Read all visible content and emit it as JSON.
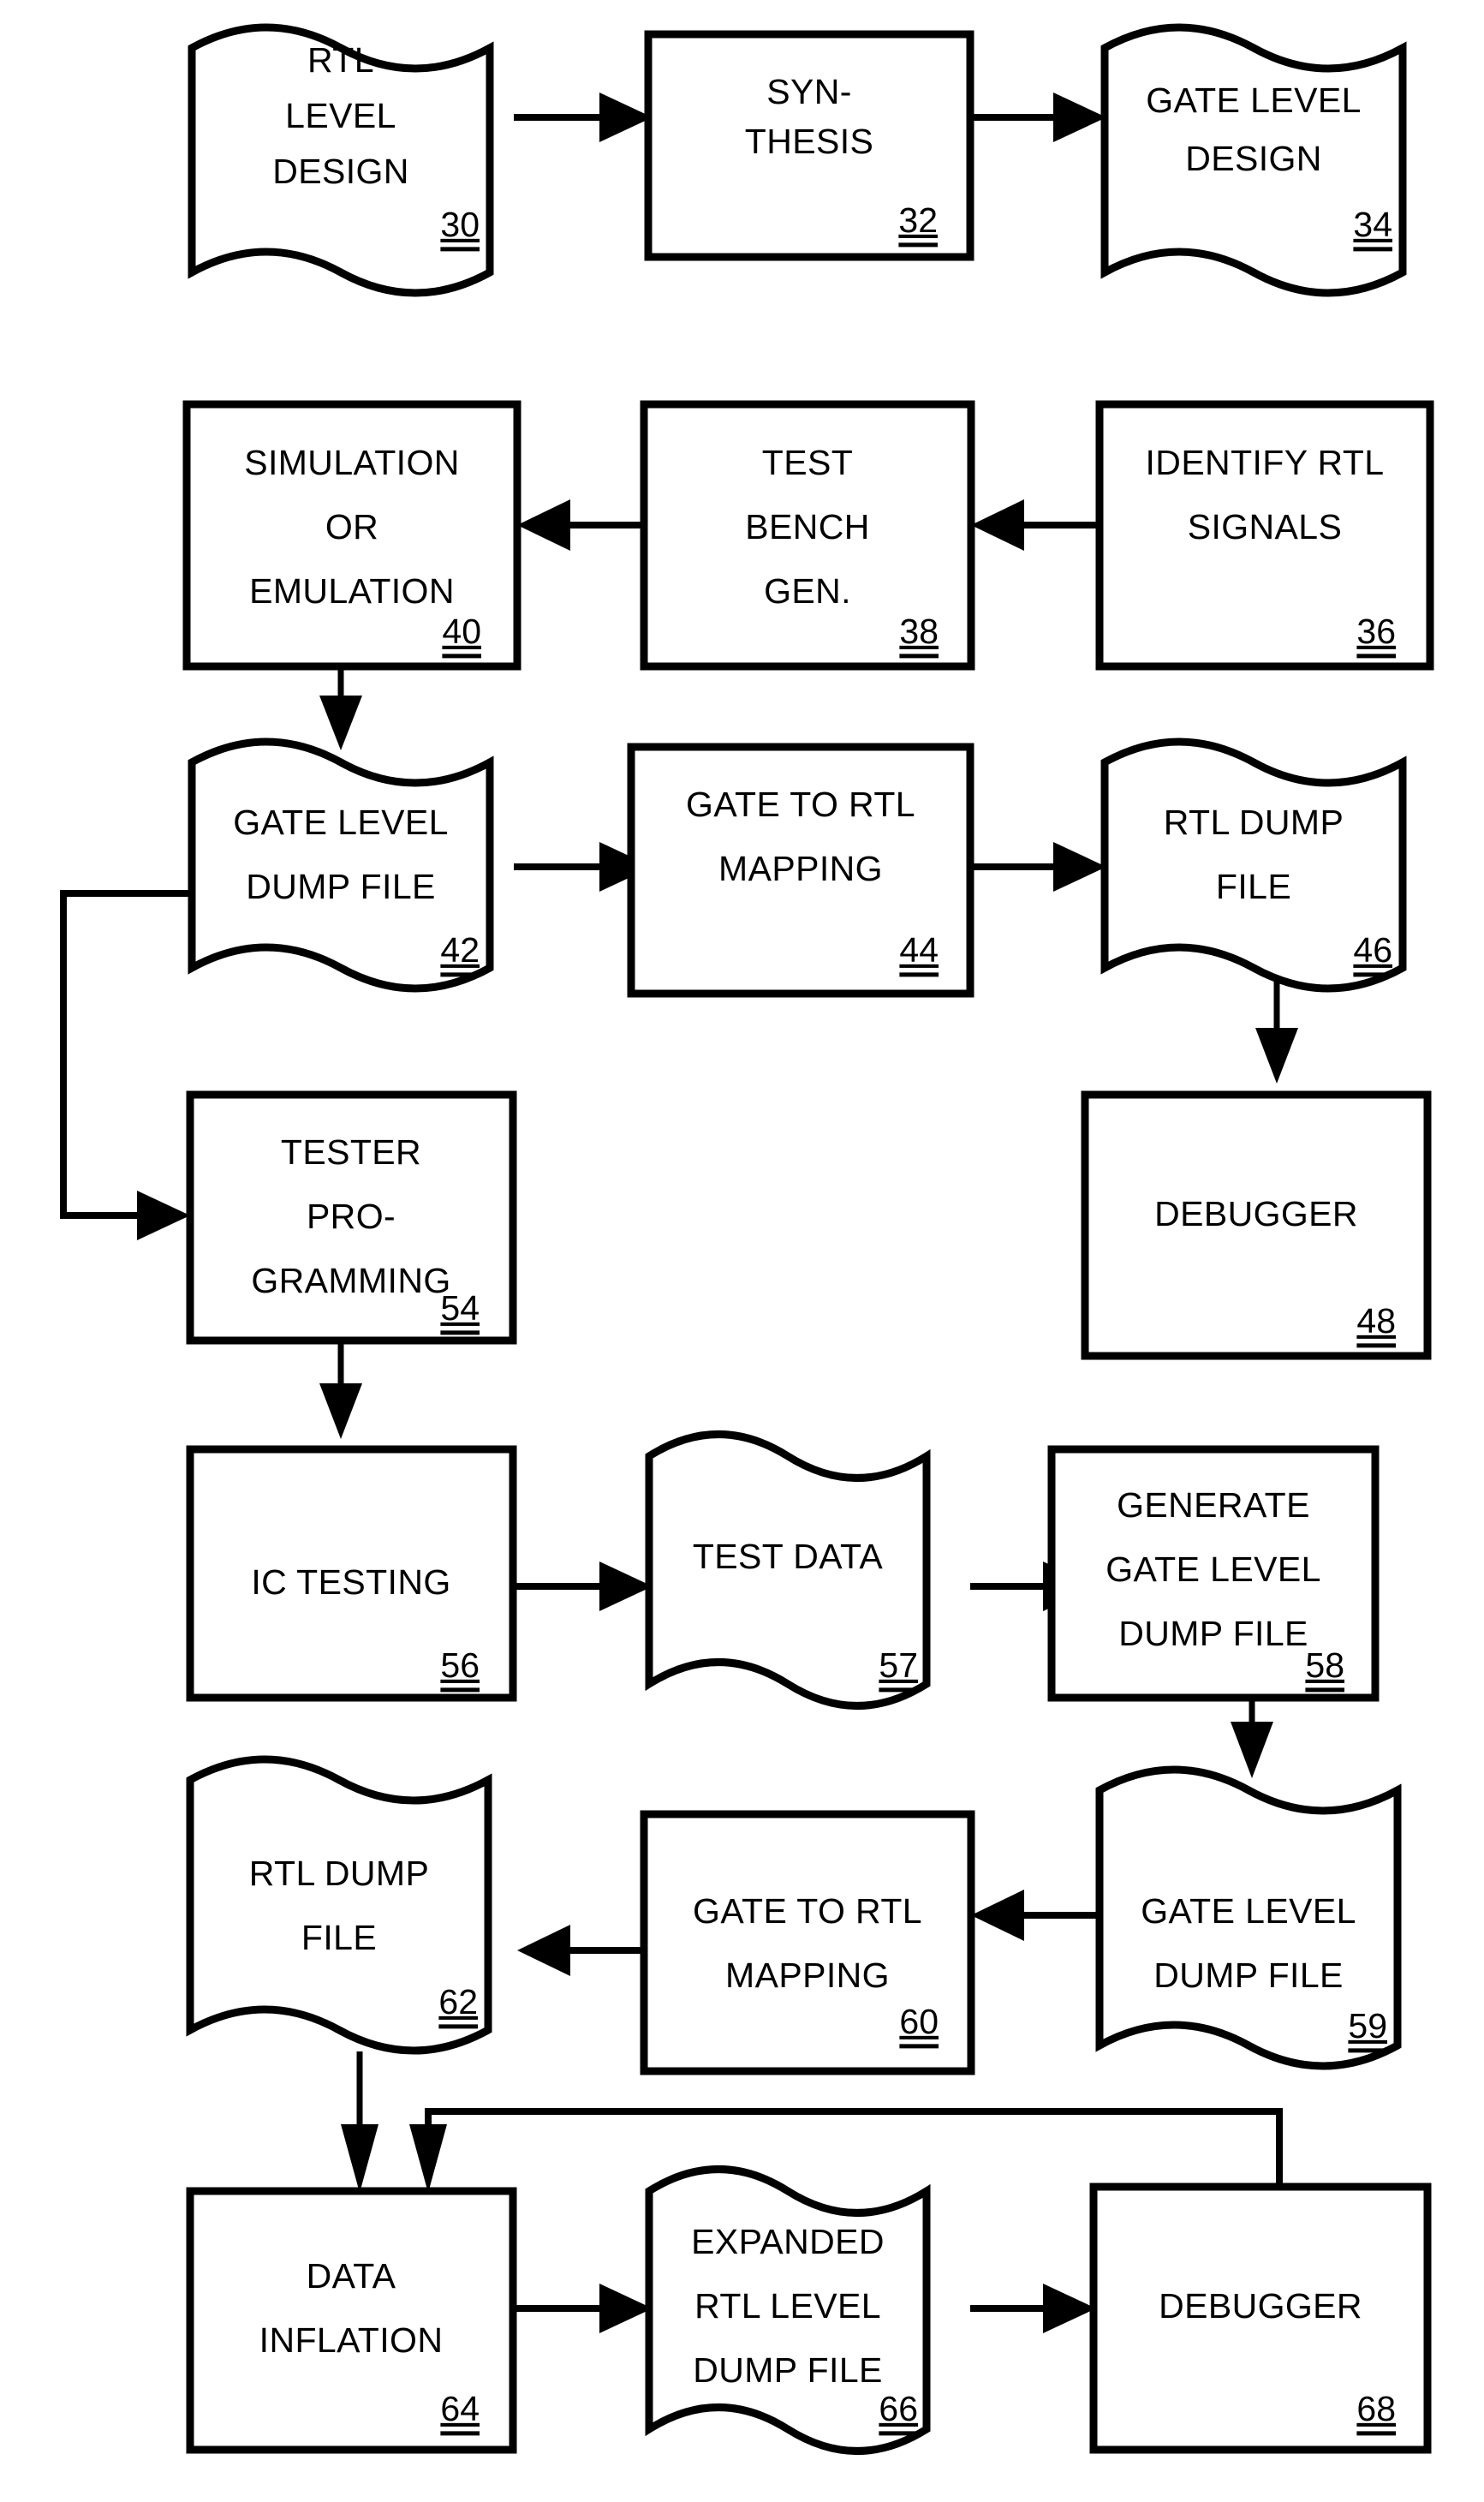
{
  "figure": {
    "type": "patent-flowchart",
    "orientation": "portrait",
    "line_color": "#000000",
    "fill_color": "#ffffff"
  },
  "nodes": [
    {
      "id": "n30",
      "ref": "30",
      "shape": "document",
      "lines": [
        "RTL",
        "LEVEL",
        "DESIGN"
      ],
      "col": 1,
      "row": 1
    },
    {
      "id": "n32",
      "ref": "32",
      "shape": "rect",
      "lines": [
        "SYN-",
        "THESIS"
      ],
      "col": 2,
      "row": 1
    },
    {
      "id": "n34",
      "ref": "34",
      "shape": "document",
      "lines": [
        "GATE LEVEL",
        "DESIGN"
      ],
      "col": 3,
      "row": 1
    },
    {
      "id": "n40",
      "ref": "40",
      "shape": "rect",
      "lines": [
        "SIMULATION",
        "OR",
        "EMULATION"
      ],
      "col": 1,
      "row": 2
    },
    {
      "id": "n38",
      "ref": "38",
      "shape": "rect",
      "lines": [
        "TEST",
        "BENCH",
        "GEN."
      ],
      "col": 2,
      "row": 2
    },
    {
      "id": "n36",
      "ref": "36",
      "shape": "rect",
      "lines": [
        "IDENTIFY RTL",
        "SIGNALS"
      ],
      "col": 3,
      "row": 2
    },
    {
      "id": "n42",
      "ref": "42",
      "shape": "document",
      "lines": [
        "GATE LEVEL",
        "DUMP FILE"
      ],
      "col": 1,
      "row": 3
    },
    {
      "id": "n44",
      "ref": "44",
      "shape": "rect",
      "lines": [
        "GATE TO RTL",
        "MAPPING"
      ],
      "col": 2,
      "row": 3
    },
    {
      "id": "n46",
      "ref": "46",
      "shape": "document",
      "lines": [
        "RTL DUMP",
        "FILE"
      ],
      "col": 3,
      "row": 3
    },
    {
      "id": "n54",
      "ref": "54",
      "shape": "rect",
      "lines": [
        "TESTER",
        "PRO-",
        "GRAMMING"
      ],
      "col": 1,
      "row": 4
    },
    {
      "id": "n48",
      "ref": "48",
      "shape": "rect",
      "lines": [
        "DEBUGGER"
      ],
      "col": 3,
      "row": 4
    },
    {
      "id": "n56",
      "ref": "56",
      "shape": "rect",
      "lines": [
        "IC TESTING"
      ],
      "col": 1,
      "row": 5
    },
    {
      "id": "n57",
      "ref": "57",
      "shape": "document",
      "lines": [
        "TEST DATA"
      ],
      "col": 2,
      "row": 5
    },
    {
      "id": "n58",
      "ref": "58",
      "shape": "rect",
      "lines": [
        "GENERATE",
        "GATE LEVEL",
        "DUMP FILE"
      ],
      "col": 3,
      "row": 5
    },
    {
      "id": "n62",
      "ref": "62",
      "shape": "document",
      "lines": [
        "RTL DUMP",
        "FILE"
      ],
      "col": 1,
      "row": 6
    },
    {
      "id": "n60",
      "ref": "60",
      "shape": "rect",
      "lines": [
        "GATE TO RTL",
        "MAPPING"
      ],
      "col": 2,
      "row": 6
    },
    {
      "id": "n59",
      "ref": "59",
      "shape": "document",
      "lines": [
        "GATE LEVEL",
        "DUMP FILE"
      ],
      "col": 3,
      "row": 6
    },
    {
      "id": "n64",
      "ref": "64",
      "shape": "rect",
      "lines": [
        "DATA",
        "INFLATION"
      ],
      "col": 1,
      "row": 7
    },
    {
      "id": "n66",
      "ref": "66",
      "shape": "document",
      "lines": [
        "EXPANDED",
        "RTL LEVEL",
        "DUMP FILE"
      ],
      "col": 2,
      "row": 7
    },
    {
      "id": "n68",
      "ref": "68",
      "shape": "rect",
      "lines": [
        "DEBUGGER"
      ],
      "col": 3,
      "row": 7
    }
  ],
  "edges": [
    {
      "from": "n30",
      "to": "n32",
      "kind": "horizontal-right"
    },
    {
      "from": "n32",
      "to": "n34",
      "kind": "horizontal-right"
    },
    {
      "from": "n34",
      "to": "n36",
      "kind": "vertical-down"
    },
    {
      "from": "n36",
      "to": "n38",
      "kind": "horizontal-left"
    },
    {
      "from": "n38",
      "to": "n40",
      "kind": "horizontal-left"
    },
    {
      "from": "n40",
      "to": "n42",
      "kind": "vertical-down"
    },
    {
      "from": "n42",
      "to": "n44",
      "kind": "horizontal-right"
    },
    {
      "from": "n44",
      "to": "n46",
      "kind": "horizontal-right"
    },
    {
      "from": "n46",
      "to": "n48",
      "kind": "vertical-down"
    },
    {
      "from": "n42",
      "to": "n54",
      "kind": "left-loop"
    },
    {
      "from": "n54",
      "to": "n56",
      "kind": "vertical-down"
    },
    {
      "from": "n56",
      "to": "n57",
      "kind": "horizontal-right"
    },
    {
      "from": "n57",
      "to": "n58",
      "kind": "horizontal-right"
    },
    {
      "from": "n58",
      "to": "n59",
      "kind": "vertical-down"
    },
    {
      "from": "n59",
      "to": "n60",
      "kind": "horizontal-left"
    },
    {
      "from": "n60",
      "to": "n62",
      "kind": "horizontal-left"
    },
    {
      "from": "n62",
      "to": "n64",
      "kind": "vertical-down"
    },
    {
      "from": "n68",
      "to": "n64",
      "kind": "right-loop"
    },
    {
      "from": "n64",
      "to": "n66",
      "kind": "horizontal-right"
    },
    {
      "from": "n66",
      "to": "n68",
      "kind": "horizontal-right"
    }
  ]
}
